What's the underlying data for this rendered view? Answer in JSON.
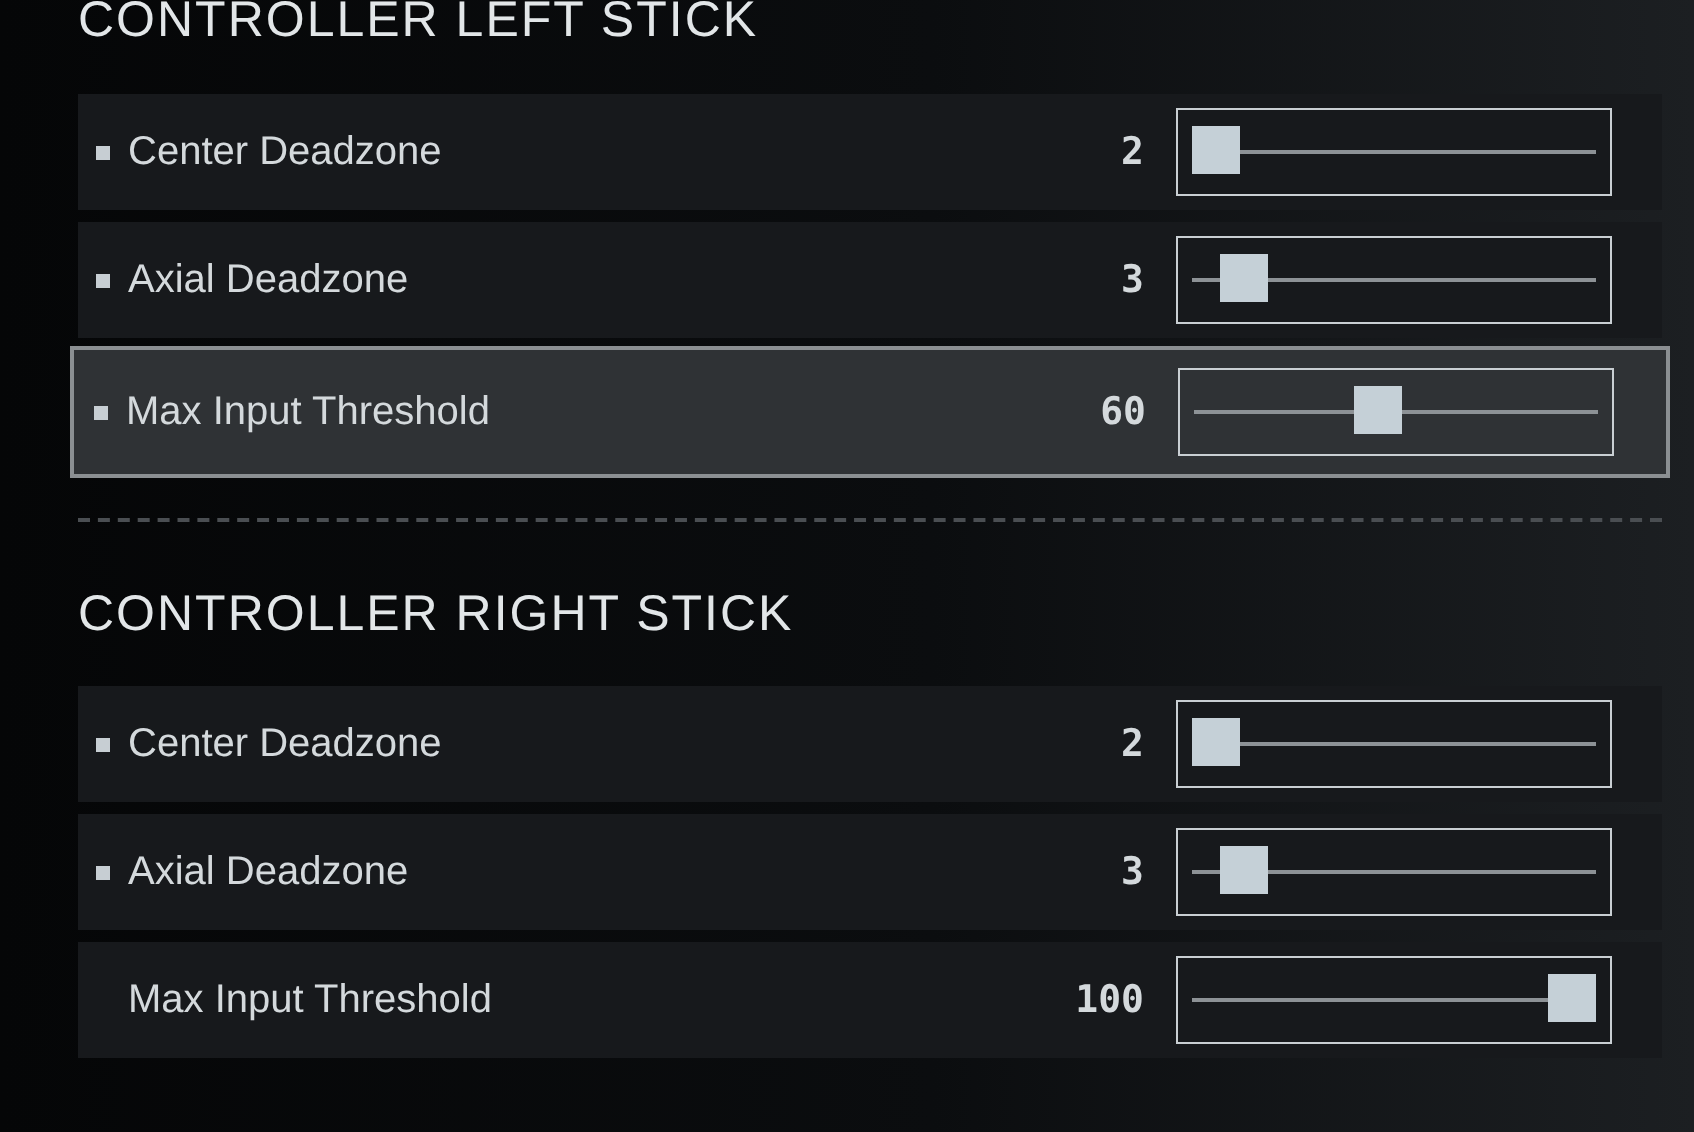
{
  "sections": [
    {
      "title": "CONTROLLER LEFT STICK",
      "settings": [
        {
          "label": "Center Deadzone",
          "value": "2",
          "level": 0,
          "modified": true,
          "selected": false
        },
        {
          "label": "Axial Deadzone",
          "value": "3",
          "level": 0.08,
          "modified": true,
          "selected": false
        },
        {
          "label": "Max Input Threshold",
          "value": "60",
          "level": 0.45,
          "modified": true,
          "selected": true
        }
      ]
    },
    {
      "title": "CONTROLLER RIGHT STICK",
      "settings": [
        {
          "label": "Center Deadzone",
          "value": "2",
          "level": 0,
          "modified": true,
          "selected": false
        },
        {
          "label": "Axial Deadzone",
          "value": "3",
          "level": 0.08,
          "modified": true,
          "selected": false
        },
        {
          "label": "Max Input Threshold",
          "value": "100",
          "level": 1,
          "modified": false,
          "selected": false
        }
      ]
    }
  ]
}
